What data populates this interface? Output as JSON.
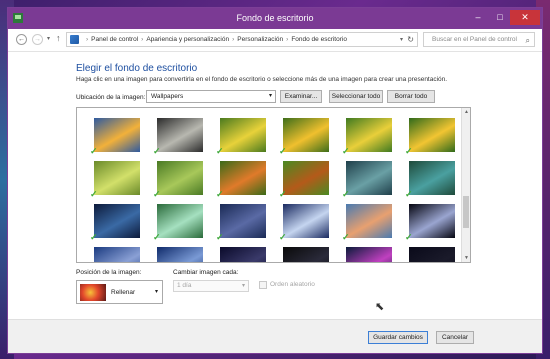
{
  "window": {
    "title": "Fondo de escritorio"
  },
  "controls": {
    "minimize": "–",
    "maximize": "□",
    "close": "✕"
  },
  "nav": {
    "back": "←",
    "forward": "→",
    "recent": "▾",
    "up": "↑",
    "breadcrumbs": [
      "Panel de control",
      "Apariencia y personalización",
      "Personalización",
      "Fondo de escritorio"
    ],
    "separator": "›",
    "dropdown": "▾",
    "refresh": "↻",
    "search_placeholder": "Buscar en el Panel de control",
    "search_icon": "⌕"
  },
  "main": {
    "heading": "Elegir el fondo de escritorio",
    "subtext": "Haga clic en una imagen para convertirla en el fondo de escritorio o seleccione más de una imagen para crear una presentación.",
    "location_label": "Ubicación de la imagen:",
    "location_value": "Wallpapers",
    "browse_label": "Examinar...",
    "select_all_label": "Seleccionar todo",
    "clear_all_label": "Borrar todo"
  },
  "gallery": {
    "check": "✓",
    "caret_up": "▲",
    "caret_down": "▼",
    "thumbs": [
      {
        "colors": [
          "#2e5aa0",
          "#f2b13a"
        ],
        "checked": true
      },
      {
        "colors": [
          "#2b2b2b",
          "#b8b8b0"
        ],
        "checked": true
      },
      {
        "colors": [
          "#4a7a1e",
          "#e8d23a"
        ],
        "checked": true
      },
      {
        "colors": [
          "#3d6e1a",
          "#f0c02e"
        ],
        "checked": true
      },
      {
        "colors": [
          "#3f7a20",
          "#e9cf3a"
        ],
        "checked": true
      },
      {
        "colors": [
          "#2f6a1b",
          "#f2c532"
        ],
        "checked": true
      },
      {
        "colors": [
          "#6a8a2a",
          "#d2e06a"
        ],
        "checked": true
      },
      {
        "colors": [
          "#4a7a24",
          "#a8c85a"
        ],
        "checked": true
      },
      {
        "colors": [
          "#3a6a18",
          "#e07a2a"
        ],
        "checked": true
      },
      {
        "colors": [
          "#4a8a22",
          "#b45a1a"
        ],
        "checked": true
      },
      {
        "colors": [
          "#1f3f4a",
          "#6aa0a5"
        ],
        "checked": true
      },
      {
        "colors": [
          "#1e4a3a",
          "#4aa0a0"
        ],
        "checked": true
      },
      {
        "colors": [
          "#0c1a3a",
          "#3a6aa5"
        ],
        "checked": true
      },
      {
        "colors": [
          "#2a6a3a",
          "#a5e0c0"
        ],
        "checked": true
      },
      {
        "colors": [
          "#1a2a55",
          "#5a6aa5"
        ],
        "checked": true
      },
      {
        "colors": [
          "#1a2a60",
          "#c5d5f0"
        ],
        "checked": true
      },
      {
        "colors": [
          "#4a7ab0",
          "#e8a070"
        ],
        "checked": true
      },
      {
        "colors": [
          "#050510",
          "#9aa5d0"
        ],
        "checked": true
      },
      {
        "colors": [
          "#1a3a80",
          "#8aa0d5"
        ],
        "checked": false
      },
      {
        "colors": [
          "#0f2a6a",
          "#7a9ad5"
        ],
        "checked": false
      },
      {
        "colors": [
          "#0a0a2a",
          "#3a3a6a"
        ],
        "checked": false
      },
      {
        "colors": [
          "#0a0a0a",
          "#2a2a3a"
        ],
        "checked": false
      },
      {
        "colors": [
          "#0a1a3a",
          "#c040c0"
        ],
        "checked": false
      },
      {
        "colors": [
          "#0a0a1a",
          "#1a1a2a"
        ],
        "checked": false
      }
    ]
  },
  "position": {
    "label": "Posición de la imagen:",
    "value": "Rellenar",
    "caret": "▾"
  },
  "interval": {
    "label": "Cambiar imagen cada:",
    "value": "1 día",
    "caret": "▾",
    "shuffle_label": "Orden aleatorio"
  },
  "footer": {
    "save_label": "Guardar cambios",
    "cancel_label": "Cancelar"
  }
}
